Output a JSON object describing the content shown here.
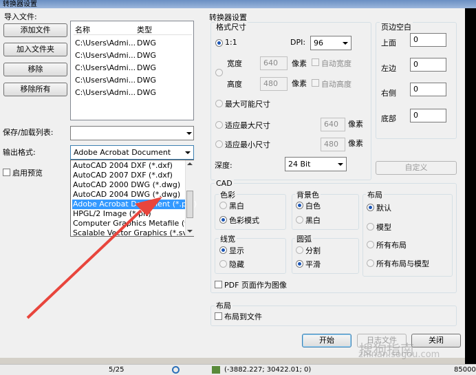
{
  "window": {
    "title": "转换器设置"
  },
  "import": {
    "section_label": "导入文件:",
    "buttons": [
      "添加文件",
      "加入文件夹",
      "移除",
      "移除所有"
    ],
    "headers": [
      "名称",
      "类型"
    ],
    "files": [
      {
        "name": "C:\\Users\\Admi...",
        "type": "DWG"
      },
      {
        "name": "C:\\Users\\Admi...",
        "type": "DWG"
      },
      {
        "name": "C:\\Users\\Admi...",
        "type": "DWG"
      },
      {
        "name": "C:\\Users\\Admi...",
        "type": "DWG"
      },
      {
        "name": "C:\\Users\\Admi...",
        "type": "DWG"
      }
    ]
  },
  "save_list": {
    "label": "保存/加载列表:",
    "value": ""
  },
  "output": {
    "label": "输出格式:",
    "value": "Adobe Acrobat Document (*.pdf,",
    "options": [
      "AutoCAD 2004 DXF (*.dxf)",
      "AutoCAD 2007 DXF (*.dxf)",
      "AutoCAD 2000 DWG (*.dwg)",
      "AutoCAD 2004 DWG (*.dwg)",
      "Adobe Acrobat Document (*.pdf)",
      "HPGL/2 Image (*.plt)",
      "Computer Graphics Metafile (*.cg",
      "Scalable Vector Graphics (*.svg)"
    ],
    "selected_index": 4
  },
  "preview": {
    "label": "启用预览"
  },
  "converter": {
    "title": "转换器设置",
    "format_size": "格式尺寸",
    "ratio": "1:1",
    "dpi_label": "DPI:",
    "dpi_value": "96",
    "width_label": "宽度",
    "width_value": "640",
    "height_label": "高度",
    "height_value": "480",
    "pixel_label": "像素",
    "auto_width": "自动宽度",
    "auto_height": "自动高度",
    "max_size": "最大可能尺寸",
    "fit_max": "适应最大尺寸",
    "fit_max_value": "640",
    "fit_min": "适应最小尺寸",
    "fit_min_value": "480",
    "depth_label": "深度:",
    "depth_value": "24 Bit"
  },
  "margins": {
    "title": "页边空白",
    "top_label": "上面",
    "top_value": "0",
    "left_label": "左边",
    "left_value": "0",
    "right_label": "右侧",
    "right_value": "0",
    "bottom_label": "底部",
    "bottom_value": "0",
    "custom_button": "自定义"
  },
  "cad": {
    "title": "CAD",
    "color_title": "色彩",
    "color_opts": [
      "黑白",
      "色彩模式"
    ],
    "bg_title": "背景色",
    "bg_opts": [
      "白色",
      "黑白"
    ],
    "layout_title": "布局",
    "layout_opts": [
      "默认",
      "模型",
      "所有布局",
      "所有布局与模型"
    ],
    "linewidth_title": "线宽",
    "linewidth_opts": [
      "显示",
      "隐藏"
    ],
    "arc_title": "圆弧",
    "arc_opts": [
      "分割",
      "平滑"
    ],
    "pdf_as_image": "PDF 页面作为图像"
  },
  "layout_section": {
    "title": "布局",
    "to_file": "布局到文件"
  },
  "footer": {
    "start": "开始",
    "log": "日志文件",
    "close": "关闭"
  },
  "statusbar": {
    "pages": "5/25",
    "coords": "(-3882.227; 30422.01; 0)",
    "right_value": "85000"
  },
  "watermark": {
    "brand": "搜狗指南",
    "url": "zhinan.sogou.com"
  },
  "colors": {
    "selection": "#3399ff",
    "arrow": "#e8453c"
  }
}
